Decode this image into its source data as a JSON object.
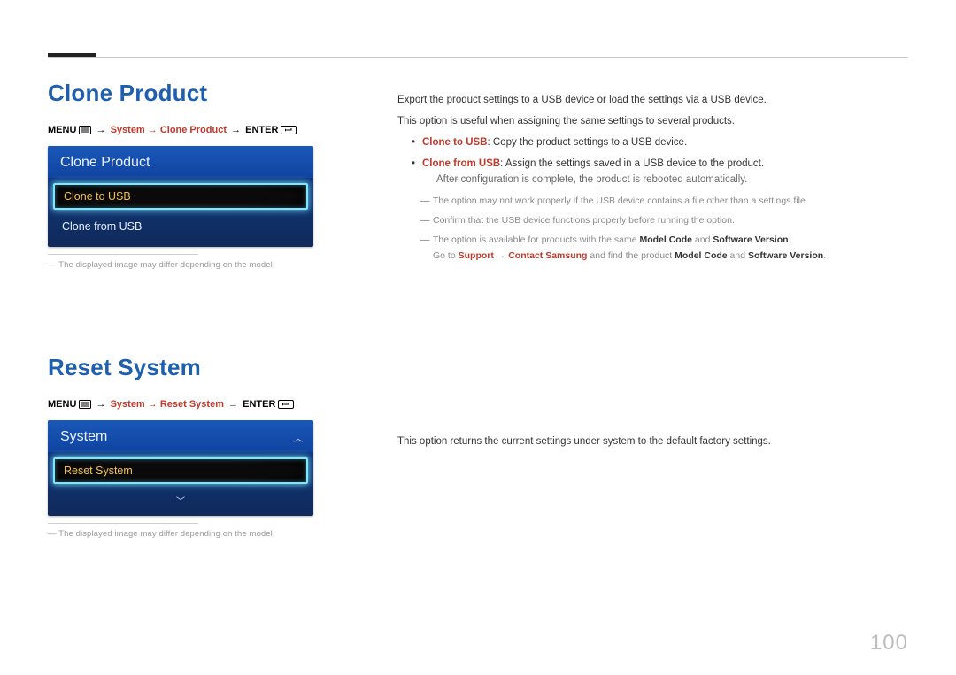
{
  "page_number": "100",
  "section1": {
    "title": "Clone Product",
    "breadcrumb": {
      "menu": "MENU",
      "mid": "System → Clone Product",
      "enter": "ENTER"
    },
    "osd": {
      "title": "Clone Product",
      "rows": [
        {
          "label": "Clone to USB",
          "selected": true
        },
        {
          "label": "Clone from USB",
          "selected": false
        }
      ]
    },
    "imgnote": "The displayed image may differ depending on the model.",
    "right": {
      "p1": "Export the product settings to a USB device or load the settings via a USB device.",
      "p2": "This option is useful when assigning the same settings to several products.",
      "b1_lead": "Clone to USB",
      "b1_rest": ": Copy the product settings to a USB device.",
      "b2_lead": "Clone from USB",
      "b2_rest": ": Assign the settings saved in a USB device to the product.",
      "s1": "After configuration is complete, the product is rebooted automatically.",
      "s2": "The option may not work properly if the USB device contains a file other than a settings file.",
      "s3": "Confirm that the USB device functions properly before running the option.",
      "s4_a": "The option is available for products with the same ",
      "s4_b": "Model Code",
      "s4_c": " and ",
      "s4_d": "Software Version",
      "s4_e": ".",
      "s5_a": "Go to ",
      "s5_b": "Support",
      "s5_c": " → ",
      "s5_d": "Contact Samsung",
      "s5_e": " and find the product ",
      "s5_f": "Model Code",
      "s5_g": " and ",
      "s5_h": "Software Version",
      "s5_i": "."
    }
  },
  "section2": {
    "title": "Reset System",
    "breadcrumb": {
      "menu": "MENU",
      "mid": "System → Reset System",
      "enter": "ENTER"
    },
    "osd": {
      "title": "System",
      "selected": "Reset System"
    },
    "imgnote": "The displayed image may differ depending on the model.",
    "right": {
      "p1": "This option returns the current settings under system to the default factory settings."
    }
  }
}
